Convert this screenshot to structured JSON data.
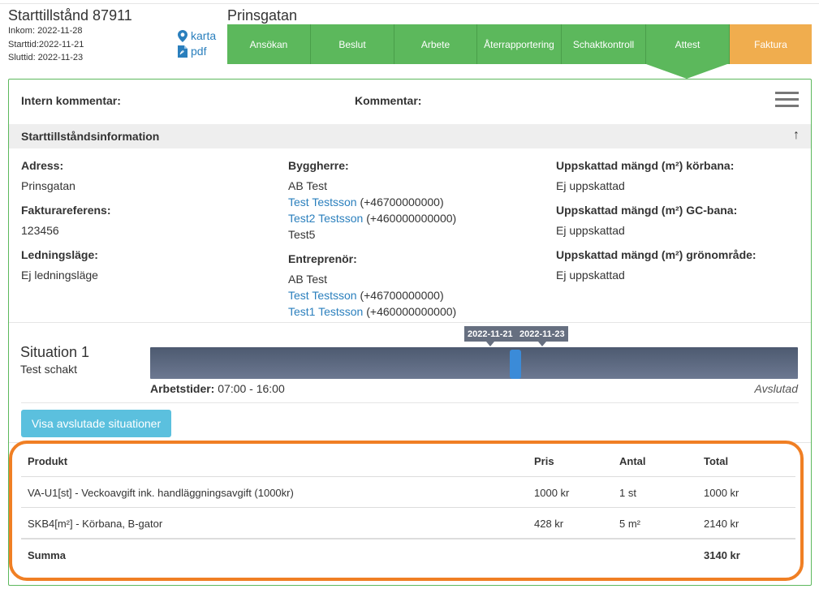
{
  "permit": {
    "title": "Starttillstånd 87911",
    "received": "Inkom:  2022-11-28",
    "start": "Starttid:2022-11-21",
    "end": "Sluttid:  2022-11-23",
    "map_link": "karta",
    "pdf_link": "pdf"
  },
  "street": "Prinsgatan",
  "steps": [
    {
      "label": "Ansökan"
    },
    {
      "label": "Beslut"
    },
    {
      "label": "Arbete"
    },
    {
      "label": "Återrapportering"
    },
    {
      "label": "Schaktkontroll"
    },
    {
      "label": "Attest"
    },
    {
      "label": "Faktura"
    }
  ],
  "comments": {
    "internal_label": "Intern kommentar:",
    "comment_label": "Kommentar:"
  },
  "info_section": {
    "title": "Starttillståndsinformation",
    "address_label": "Adress:",
    "address": "Prinsgatan",
    "invoice_ref_label": "Fakturareferens:",
    "invoice_ref": "123456",
    "cable_label": "Ledningsläge:",
    "cable": "Ej ledningsläge",
    "builder_label": "Byggherre:",
    "builder_company": "AB Test",
    "builder_contact1_name": "Test Testsson",
    "builder_contact1_phone": " (+46700000000)",
    "builder_contact2_name": "Test2 Testsson",
    "builder_contact2_phone": " (+460000000000)",
    "builder_other": "Test5",
    "contractor_label": "Entreprenör:",
    "contractor_company": "AB Test",
    "contractor_contact1_name": "Test Testsson",
    "contractor_contact1_phone": " (+46700000000)",
    "contractor_contact2_name": "Test1 Testsson",
    "contractor_contact2_phone": " (+460000000000)",
    "road_label": "Uppskattad mängd (m²) körbana:",
    "road_value": "Ej uppskattad",
    "cycle_label": "Uppskattad mängd (m²) GC-bana:",
    "cycle_value": "Ej uppskattad",
    "green_label": "Uppskattad mängd (m²) grönområde:",
    "green_value": "Ej uppskattad"
  },
  "situation": {
    "title": "Situation 1",
    "subtitle": "Test schakt",
    "date_start": "2022-11-21",
    "date_end": "2022-11-23",
    "worktimes_label": "Arbetstider:",
    "worktimes": " 07:00 - 16:00",
    "status": "Avslutad",
    "show_button": "Visa avslutade situationer"
  },
  "products": {
    "headers": {
      "product": "Produkt",
      "price": "Pris",
      "quantity": "Antal",
      "total": "Total"
    },
    "rows": [
      {
        "product": "VA-U1[st] - Veckoavgift ink. handläggningsavgift (1000kr)",
        "price": "1000 kr",
        "quantity": "1 st",
        "total": "1000 kr"
      },
      {
        "product": "SKB4[m²] - Körbana, B-gator",
        "price": "428 kr",
        "quantity": "5 m²",
        "total": "2140 kr"
      }
    ],
    "sum_label": "Summa",
    "sum_value": "3140 kr"
  },
  "colors": {
    "step_green": "#5cb85c",
    "step_orange": "#f0ad4e",
    "link_blue": "#2a7fbd",
    "button_info": "#5bc0de",
    "highlight_orange": "#f07f24"
  }
}
